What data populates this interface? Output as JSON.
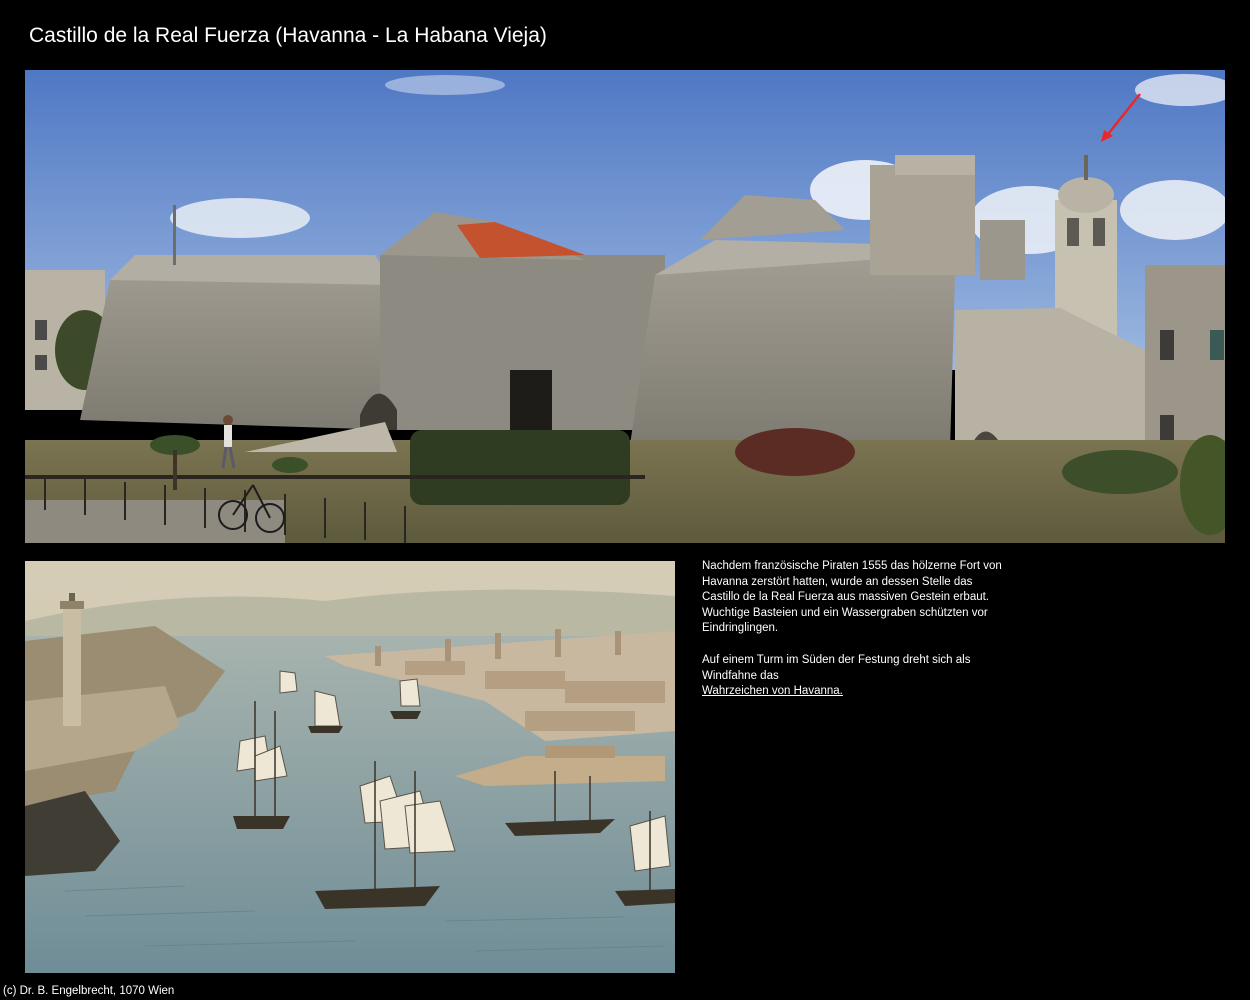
{
  "page": {
    "title": "Castillo de la Real Fuerza (Havanna - La Habana Vieja)",
    "footer": "(c) Dr. B. Engelbrecht, 1070 Wien"
  },
  "photo": {
    "subject": "Castillo de la Real Fuerza fortress walls with bell tower and weather vane, arrow pointing to the vane",
    "colors": {
      "sky": "#5e86cf",
      "stone": "#8d8b83",
      "roof": "#c5522e",
      "grass": "#6e6a4a",
      "arrow": "#e8282d"
    }
  },
  "painting": {
    "subject": "Historic illustration of Havana harbour with lighthouse fortress and sailing ships"
  },
  "description": {
    "paragraph_1": "Nachdem französische Piraten 1555 das hölzerne Fort von Havanna zerstört hatten, wurde an dessen Stelle das Castillo de la Real Fuerza aus massiven Gestein erbaut. Wuchtige Basteien und ein Wassergraben schützten vor Eindringlingen.",
    "paragraph_2": "Auf einem Turm im Süden der Festung dreht sich als Windfahne das",
    "link": "Wahrzeichen von Havanna."
  }
}
